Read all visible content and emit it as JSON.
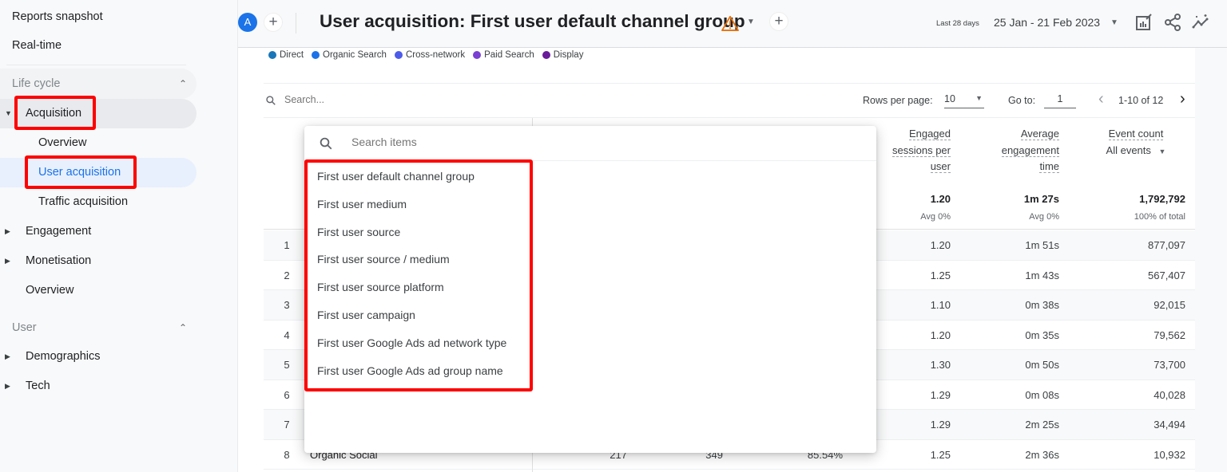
{
  "sidebar": {
    "top_items": [
      "Reports snapshot",
      "Real-time"
    ],
    "sections": [
      {
        "label": "Life cycle",
        "items": [
          {
            "label": "Acquisition",
            "expandable": true,
            "expanded": true
          },
          {
            "label": "Overview",
            "sub": true
          },
          {
            "label": "User acquisition",
            "sub": true,
            "selected": true
          },
          {
            "label": "Traffic acquisition",
            "sub": true
          },
          {
            "label": "Engagement",
            "expandable": true
          },
          {
            "label": "Monetisation",
            "expandable": true
          },
          {
            "label": "Overview"
          }
        ]
      },
      {
        "label": "User",
        "items": [
          {
            "label": "Demographics",
            "expandable": true
          },
          {
            "label": "Tech",
            "expandable": true
          }
        ]
      }
    ]
  },
  "header": {
    "avatar_letter": "A",
    "title": "User acquisition: First user default channel group",
    "date_label_small": "Last 28 days",
    "date_range": "25 Jan - 21 Feb 2023",
    "icons": [
      "add-comparison-icon",
      "warning-icon",
      "add-icon",
      "customize-report-icon",
      "share-icon",
      "insights-icon"
    ]
  },
  "legend": [
    {
      "label": "Direct",
      "color": "#1976b8"
    },
    {
      "label": "Organic Search",
      "color": "#1a73e8"
    },
    {
      "label": "Cross-network",
      "color": "#4c5be8"
    },
    {
      "label": "Paid Search",
      "color": "#7b3fd4"
    },
    {
      "label": "Display",
      "color": "#6a1b9a"
    }
  ],
  "toolbar": {
    "search_placeholder": "Search...",
    "rows_per_page_label": "Rows per page:",
    "rows_per_page_value": "10",
    "goto_label": "Go to:",
    "goto_value": "1",
    "pager_text": "1-10 of 12"
  },
  "table": {
    "headers": [
      {
        "lines": [
          "Engaged",
          "sessions per",
          "user"
        ]
      },
      {
        "lines": [
          "Average",
          "engagement",
          "time"
        ]
      },
      {
        "lines": [
          "Event count"
        ],
        "sub_select": "All events"
      }
    ],
    "totals": [
      {
        "value": "1.20",
        "sub": "Avg 0%"
      },
      {
        "value": "1m 27s",
        "sub": "Avg 0%"
      },
      {
        "value": "1,792,792",
        "sub": "100% of total"
      }
    ],
    "rows": [
      {
        "idx": "1",
        "name": "",
        "engaged_per_user": "1.20",
        "avg_time": "1m 51s",
        "event_count": "877,097"
      },
      {
        "idx": "2",
        "name": "",
        "engaged_per_user": "1.25",
        "avg_time": "1m 43s",
        "event_count": "567,407"
      },
      {
        "idx": "3",
        "name": "",
        "engaged_per_user": "1.10",
        "avg_time": "0m 38s",
        "event_count": "92,015"
      },
      {
        "idx": "4",
        "name": "",
        "engaged_per_user": "1.20",
        "avg_time": "0m 35s",
        "event_count": "79,562"
      },
      {
        "idx": "5",
        "name": "",
        "engaged_per_user": "1.30",
        "avg_time": "0m 50s",
        "event_count": "73,700"
      },
      {
        "idx": "6",
        "name": "",
        "engaged_per_user": "1.29",
        "avg_time": "0m 08s",
        "event_count": "40,028"
      },
      {
        "idx": "7",
        "name": "",
        "engaged_per_user": "1.29",
        "avg_time": "2m 25s",
        "event_count": "34,494"
      },
      {
        "idx": "8",
        "name": "Organic Social",
        "users": "217",
        "new_users": "349",
        "rate": "85.54%",
        "engaged_per_user": "1.25",
        "avg_time": "2m 36s",
        "event_count": "10,932"
      }
    ]
  },
  "dropdown": {
    "search_placeholder": "Search items",
    "items": [
      "First user default channel group",
      "First user medium",
      "First user source",
      "First user source / medium",
      "First user source platform",
      "First user campaign",
      "First user Google Ads ad network type",
      "First user Google Ads ad group name"
    ]
  }
}
